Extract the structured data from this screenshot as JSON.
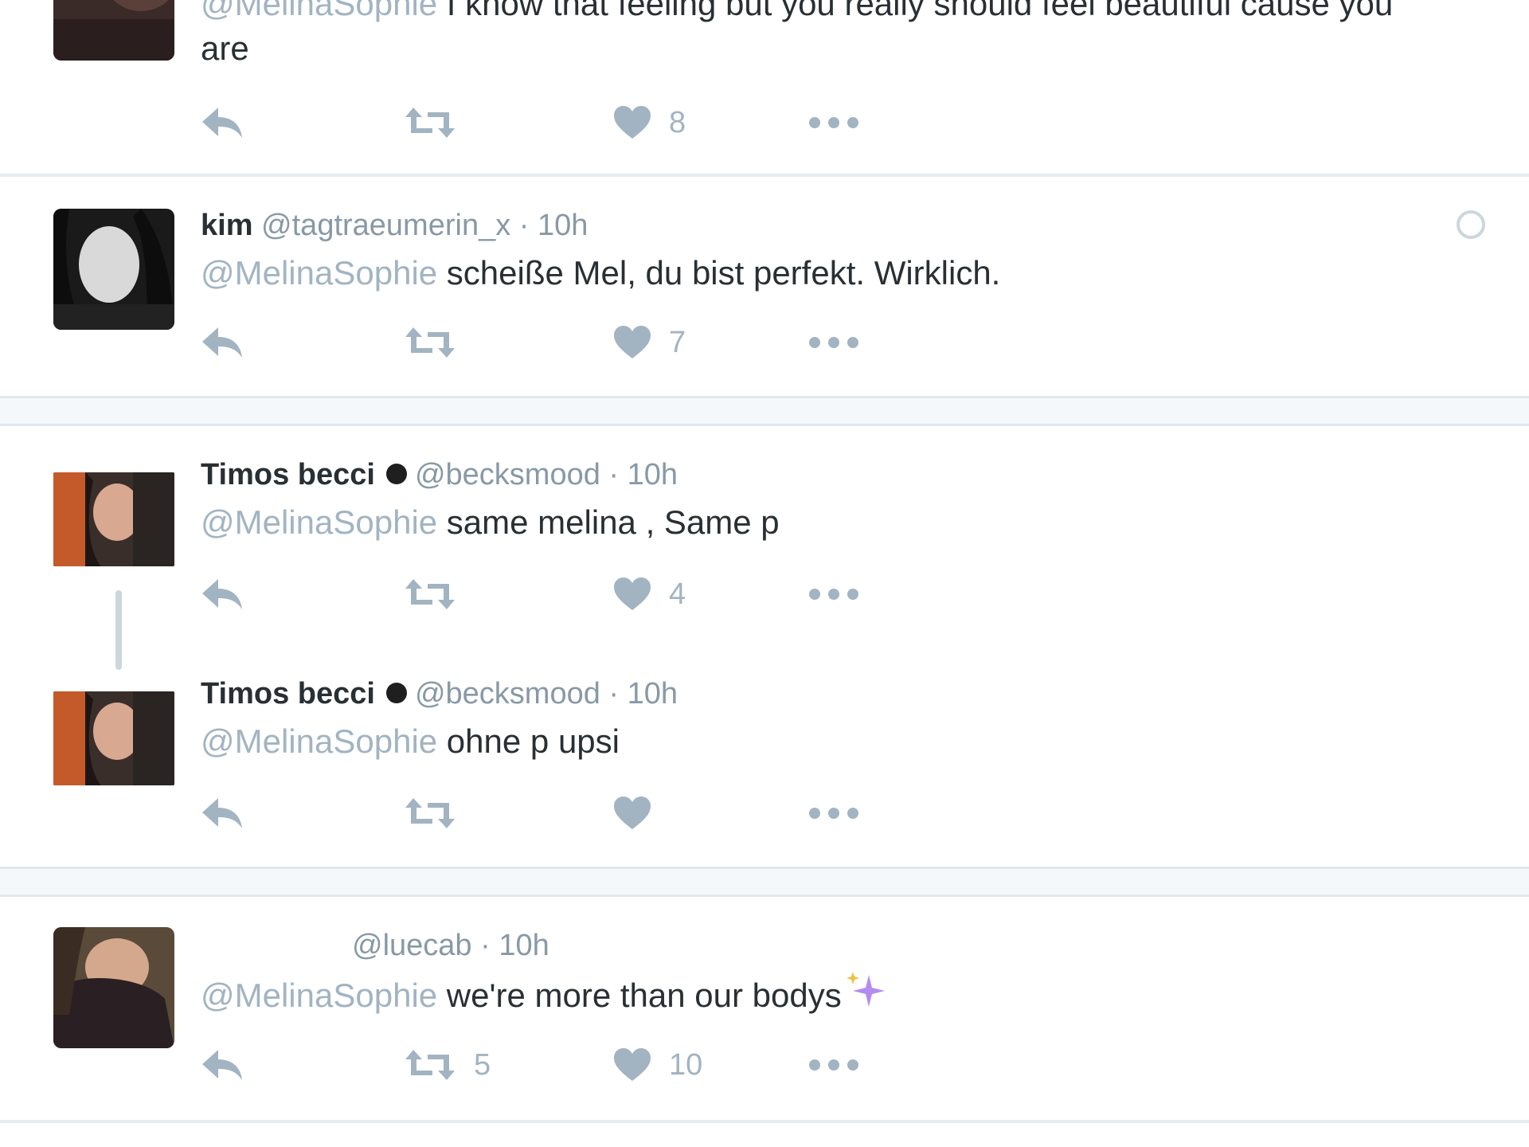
{
  "colors": {
    "name": "#292f33",
    "meta": "#8899a6",
    "mention": "#a2b4c2",
    "icon": "#a2b4c2",
    "separator": "#e6ecf0",
    "sparkle": "#b48cf0"
  },
  "tweets": [
    {
      "mention": "@MelinaSophie",
      "text": " I know that feeling but you really should feel beautiful cause you",
      "text_line2": "are",
      "likes": "8"
    },
    {
      "name": "kim",
      "handle": "@tagtraeumerin_x",
      "dot": " · ",
      "time": "10h",
      "mention": "@MelinaSophie",
      "text": " scheiße Mel, du bist perfekt. Wirklich.",
      "likes": "7"
    },
    {
      "name": "Timos becci",
      "handle": "@becksmood",
      "dot": " · ",
      "time": "10h",
      "mention": "@MelinaSophie",
      "text": " same melina , Same p",
      "likes": "4"
    },
    {
      "name": "Timos becci",
      "handle": "@becksmood",
      "dot": " · ",
      "time": "10h",
      "mention": "@MelinaSophie",
      "text": " ohne p upsi",
      "likes": ""
    },
    {
      "handle": "@luecab",
      "dot": " · ",
      "time": "10h",
      "mention": "@MelinaSophie",
      "text": " we're more than our bodys",
      "retweets": "5",
      "likes": "10"
    }
  ],
  "icons": {
    "reply": "reply-icon",
    "retweet": "retweet-icon",
    "like": "heart-icon",
    "more": "more-icon",
    "caret": "caret-icon",
    "sparkle": "sparkles-icon",
    "badge": "black-heart-icon"
  }
}
